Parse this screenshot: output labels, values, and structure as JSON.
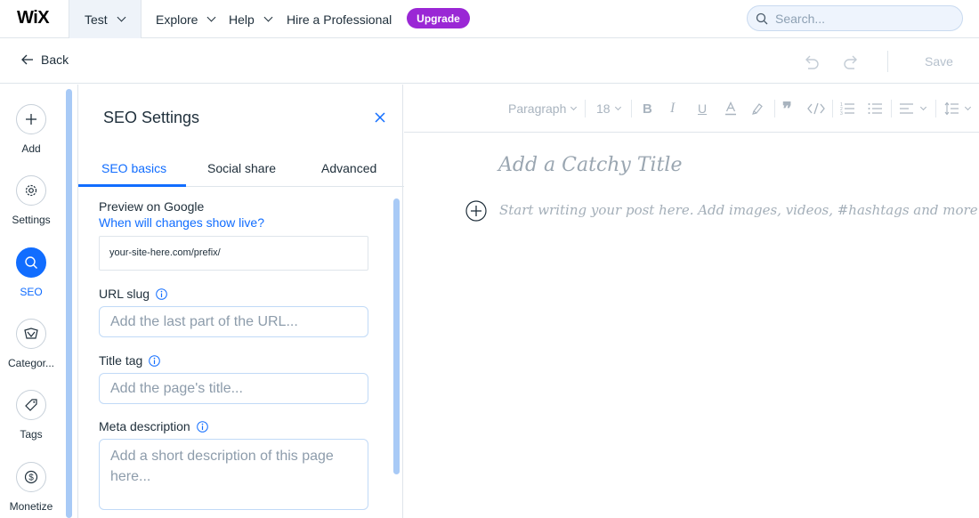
{
  "topbar": {
    "logo": "WiX",
    "site_name": "Test",
    "nav": {
      "explore": "Explore",
      "help": "Help",
      "hire": "Hire a Professional"
    },
    "upgrade": "Upgrade",
    "search_placeholder": "Search..."
  },
  "subbar": {
    "back": "Back",
    "save": "Save"
  },
  "rail": {
    "items": [
      {
        "label": "Add",
        "icon": "plus-icon"
      },
      {
        "label": "Settings",
        "icon": "gear-icon"
      },
      {
        "label": "SEO",
        "icon": "search-icon",
        "active": true
      },
      {
        "label": "Categor...",
        "icon": "categories-icon"
      },
      {
        "label": "Tags",
        "icon": "tag-icon"
      },
      {
        "label": "Monetize",
        "icon": "dollar-icon"
      }
    ]
  },
  "panel": {
    "title": "SEO Settings",
    "tabs": [
      "SEO basics",
      "Social share",
      "Advanced"
    ],
    "active_tab": "SEO basics",
    "preview_label": "Preview on Google",
    "preview_link": "When will changes show live?",
    "preview_url": "your-site-here.com/prefix/",
    "url_slug_label": "URL slug",
    "url_slug_placeholder": "Add the last part of the URL...",
    "title_tag_label": "Title tag",
    "title_tag_placeholder": "Add the page's title...",
    "meta_label": "Meta description",
    "meta_placeholder": "Add a short description of this page here..."
  },
  "editor": {
    "toolbar": {
      "style": "Paragraph",
      "font_size": "18"
    },
    "title_placeholder": "Add a Catchy Title",
    "body_placeholder": "Start writing your post here. Add images, videos, #hashtags and more."
  },
  "colors": {
    "accent": "#116dff",
    "upgrade": "#9a27d5",
    "scrollbar": "#a8caf6"
  }
}
